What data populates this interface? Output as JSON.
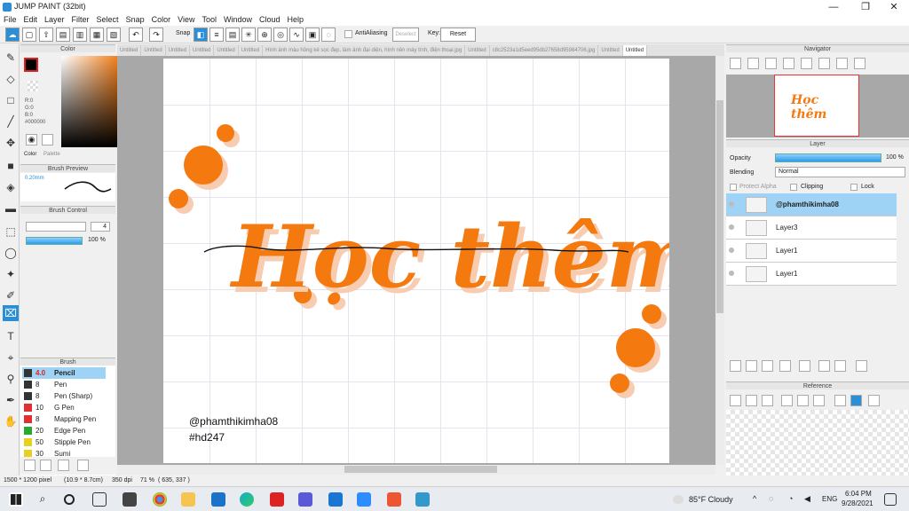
{
  "window": {
    "title": "JUMP PAINT (32bit)"
  },
  "menu": [
    "File",
    "Edit",
    "Layer",
    "Filter",
    "Select",
    "Snap",
    "Color",
    "View",
    "Tool",
    "Window",
    "Cloud",
    "Help"
  ],
  "toolbar": {
    "snap_label": "Snap",
    "antialias_label": "AntiAliasing",
    "deselect_label": "Deselect",
    "key_label": "Key:",
    "reset_label": "Reset"
  },
  "tabs": [
    "Untitled",
    "Untitled",
    "Untitled",
    "Untitled",
    "Untitled",
    "Untitled",
    "Hình ảnh màu hồng kẻ sọc đẹp, làm ảnh đại diện, hình nền máy tính, điện thoại.jpg",
    "Untitled",
    "c8c2523a1d5eed95db27658d95984706.jpg",
    "Untitled",
    "Untitled"
  ],
  "color_panel": {
    "title": "Color",
    "r": "R:0",
    "g": "G:0",
    "b": "B:0",
    "hex": "#000000",
    "tab_color": "Color",
    "tab_palette": "Palette"
  },
  "brush_preview": {
    "title": "Brush Preview",
    "size": "0.20mm"
  },
  "brush_control": {
    "title": "Brush Control",
    "size": "4",
    "opacity": "100 %"
  },
  "brush": {
    "title": "Brush",
    "items": [
      {
        "size": "4.0",
        "name": "Pencil",
        "color": "#333333"
      },
      {
        "size": "8",
        "name": "Pen",
        "color": "#333333"
      },
      {
        "size": "8",
        "name": "Pen (Sharp)",
        "color": "#333333"
      },
      {
        "size": "10",
        "name": "G Pen",
        "color": "#e03030"
      },
      {
        "size": "8",
        "name": "Mapping Pen",
        "color": "#e03030"
      },
      {
        "size": "20",
        "name": "Edge Pen",
        "color": "#22aa33"
      },
      {
        "size": "50",
        "name": "Stipple Pen",
        "color": "#e8d020"
      },
      {
        "size": "30",
        "name": "Sumi",
        "color": "#e8d020"
      }
    ]
  },
  "canvas": {
    "title_text": "Học thêm",
    "handle": "@phamthikimha08",
    "tag": "#hd247",
    "accent": "#f47a10",
    "shadow": "#f8ccb0"
  },
  "navigator": {
    "title": "Navigator"
  },
  "layer_panel": {
    "title": "Layer",
    "opacity_label": "Opacity",
    "opacity_value": "100 %",
    "blending_label": "Blending",
    "blending_value": "Normal",
    "protect_alpha": "Protect Alpha",
    "clipping": "Clipping",
    "lock": "Lock",
    "layers": [
      "@phamthikimha08",
      "Layer3",
      "Layer1",
      "Layer1"
    ]
  },
  "reference": {
    "title": "Reference"
  },
  "status": {
    "size": "1500 * 1200 pixel",
    "cm": "(10.9 * 8.7cm)",
    "dpi": "350 dpi",
    "zoom": "71 %",
    "coords": "( 635, 337 )"
  },
  "taskbar": {
    "weather": "85°F Cloudy",
    "lang": "ENG",
    "time": "6:04 PM",
    "date": "9/28/2021"
  }
}
